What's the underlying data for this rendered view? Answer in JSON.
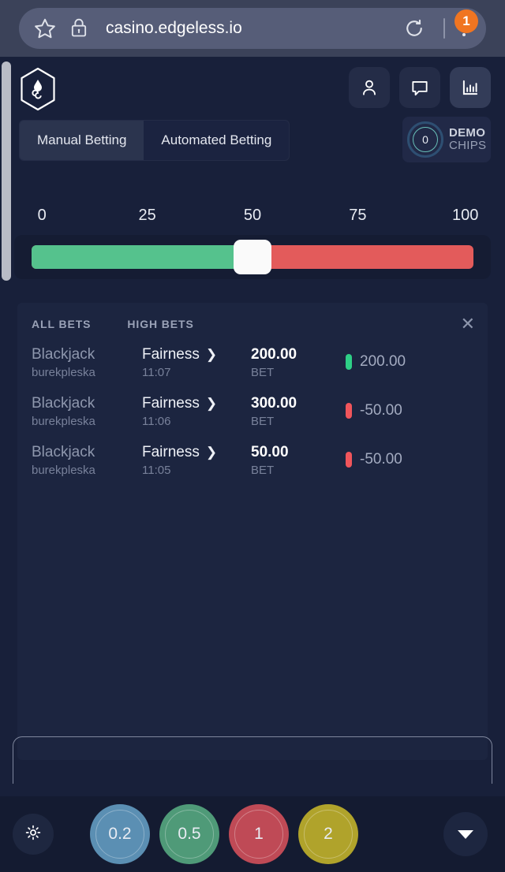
{
  "browser": {
    "url": "casino.edgeless.io",
    "star_icon": "star-icon",
    "lock_icon": "lock-icon",
    "reload_icon": "reload-icon",
    "menu_icon": "overflow-menu-icon",
    "notification_count": "1"
  },
  "header": {
    "logo_icon": "edgeless-hexagon-logo-icon",
    "actions": [
      {
        "name": "profile-button",
        "icon": "user-icon",
        "active": false
      },
      {
        "name": "chat-button",
        "icon": "chat-bubble-icon",
        "active": false
      },
      {
        "name": "statistics-button",
        "icon": "bar-chart-icon",
        "active": true
      }
    ]
  },
  "tabs": [
    {
      "label": "Manual Betting",
      "active": true
    },
    {
      "label": "Automated Betting",
      "active": false
    }
  ],
  "balance": {
    "amount": "0",
    "line1": "DEMO",
    "line2": "CHIPS"
  },
  "slider": {
    "ticks": [
      "0",
      "25",
      "50",
      "75",
      "100"
    ],
    "value": 50,
    "min": 0,
    "max": 100,
    "low_color": "#55c28d",
    "high_color": "#e35b5b"
  },
  "bets": {
    "tabs": [
      {
        "label": "ALL BETS",
        "active": true
      },
      {
        "label": "HIGH BETS",
        "active": false
      }
    ],
    "close_icon": "close-icon",
    "rows": [
      {
        "game": "Blackjack",
        "player": "burekpleska",
        "fairness": "Fairness",
        "time": "11:07",
        "amount": "200.00",
        "amount_label": "BET",
        "result": "200.00",
        "result_type": "win"
      },
      {
        "game": "Blackjack",
        "player": "burekpleska",
        "fairness": "Fairness",
        "time": "11:06",
        "amount": "300.00",
        "amount_label": "BET",
        "result": "-50.00",
        "result_type": "loss"
      },
      {
        "game": "Blackjack",
        "player": "burekpleska",
        "fairness": "Fairness",
        "time": "11:05",
        "amount": "50.00",
        "amount_label": "BET",
        "result": "-50.00",
        "result_type": "loss"
      }
    ]
  },
  "bet_input": {
    "value": "",
    "placeholder": ""
  },
  "bottom": {
    "settings_icon": "gear-icon",
    "collapse_icon": "chevron-down-icon",
    "chips": [
      {
        "value": "0.2",
        "color": "#5b8fb3"
      },
      {
        "value": "0.5",
        "color": "#4f9a78"
      },
      {
        "value": "1",
        "color": "#bf4a56"
      },
      {
        "value": "2",
        "color": "#b0a32b"
      }
    ]
  }
}
